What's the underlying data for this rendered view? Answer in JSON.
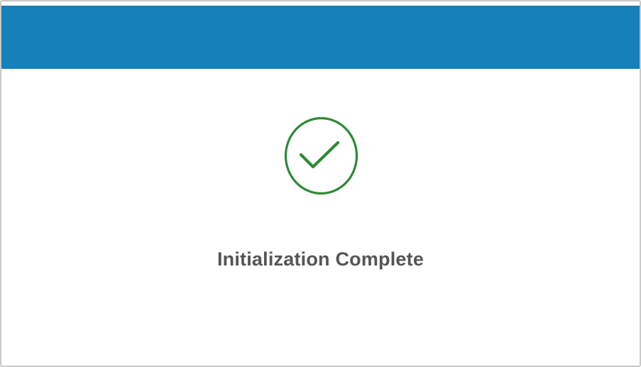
{
  "dialog": {
    "status_icon": "check-circle-icon",
    "status_text": "Initialization Complete"
  },
  "colors": {
    "header_bar": "#1580BA",
    "success_icon": "#2E8B34",
    "status_text": "#555555",
    "background": "#FFFFFF"
  }
}
